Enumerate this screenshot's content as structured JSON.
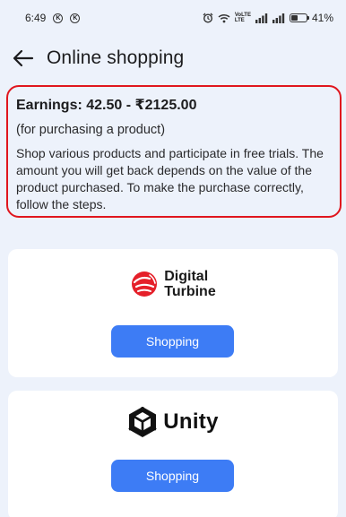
{
  "status_bar": {
    "time": "6:49",
    "badges": [
      "K",
      "K"
    ],
    "network_label_top": "VoLTE",
    "network_label_bottom": "LTE",
    "battery": "41%",
    "battery_level": 0.41
  },
  "header": {
    "title": "Online shopping",
    "back_icon": "arrow-left-icon"
  },
  "info": {
    "earnings": "Earnings: 42.50 - ₹2125.00",
    "subnote": "(for purchasing a product)",
    "description": "Shop various products and participate in free trials. The amount you will get back depends on the value of the product purchased. To make the purchase correctly, follow the steps.",
    "border_color": "#e0161e"
  },
  "offers": [
    {
      "brand_line1": "Digital",
      "brand_line2": "Turbine",
      "button_label": "Shopping",
      "logo_color": "#e5202a"
    },
    {
      "brand": "Unity",
      "button_label": "Shopping",
      "logo_color": "#111111"
    }
  ],
  "colors": {
    "background": "#edf2fb",
    "button": "#3d7cf5"
  }
}
